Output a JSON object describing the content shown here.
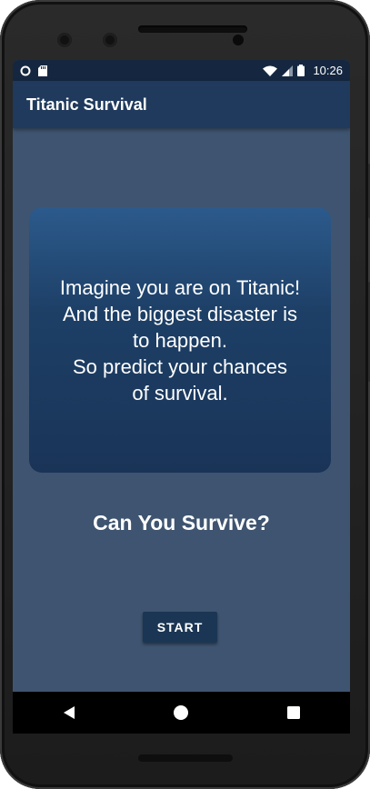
{
  "status_bar": {
    "time": "10:26",
    "left_icons": [
      "circle-status-icon",
      "sd-card-icon"
    ],
    "right_icons": [
      "wifi-icon",
      "signal-icon",
      "battery-icon"
    ]
  },
  "app_bar": {
    "title": "Titanic Survival"
  },
  "main": {
    "intro_text": "Imagine you are on Titanic!\n And the biggest disaster is\n to happen.\n So predict your chances\n of survival.",
    "headline": "Can You Survive?",
    "start_button": "START"
  },
  "nav_bar": {
    "buttons": [
      "back-icon",
      "home-icon",
      "recents-icon"
    ]
  },
  "colors": {
    "screen_bg": "#3e5470",
    "app_bar": "#1f3a5c",
    "status_bar": "#152740",
    "card_top": "#2c5a8c",
    "card_bottom": "#1a3458",
    "button": "#1b3654"
  }
}
